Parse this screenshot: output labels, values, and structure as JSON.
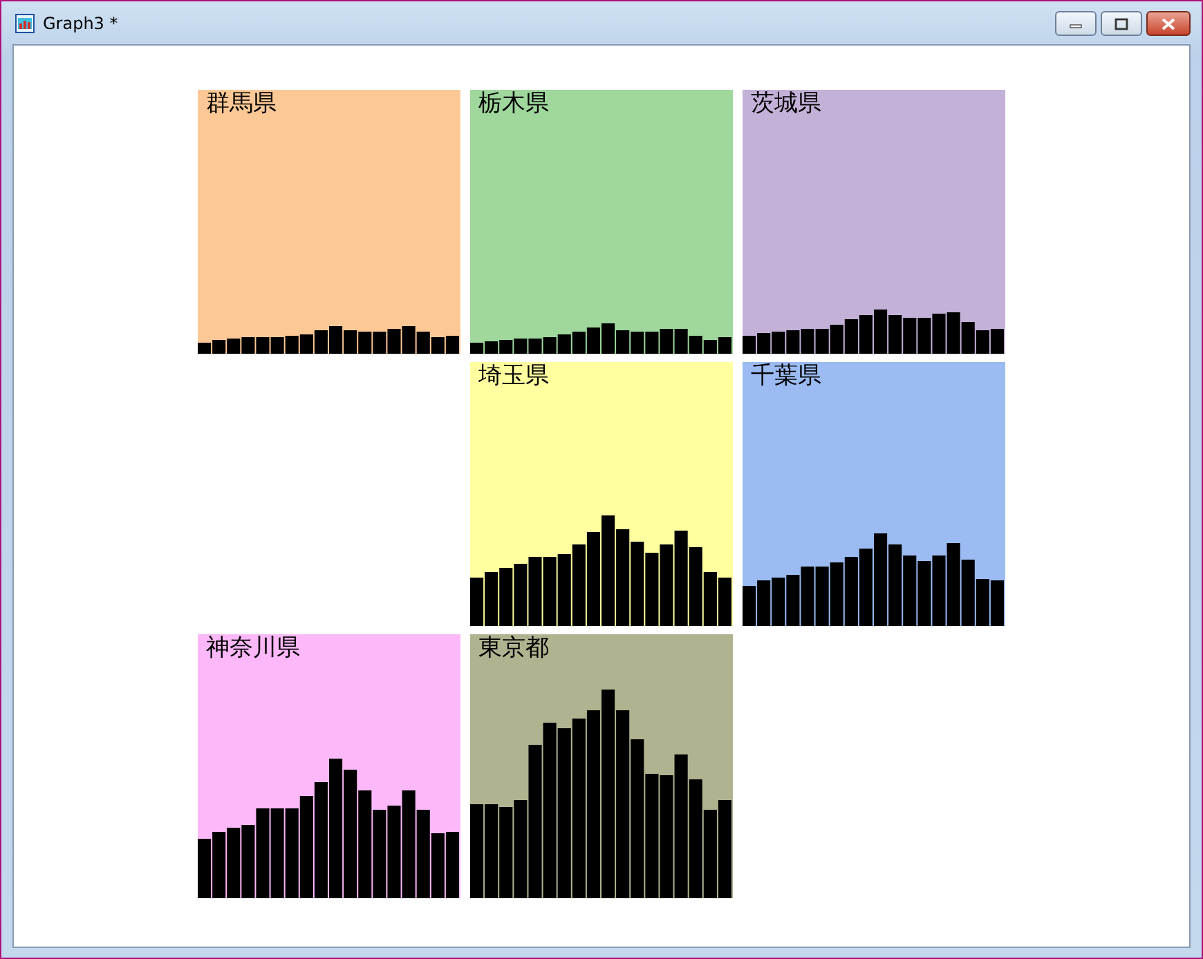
{
  "window": {
    "title": "Graph3 *"
  },
  "panels": [
    {
      "label": "群馬県",
      "color": "#fcc896"
    },
    {
      "label": "栃木県",
      "color": "#9fd79d"
    },
    {
      "label": "茨城県",
      "color": "#c3b1d7"
    },
    {
      "label": "埼玉県",
      "color": "#ffffa0"
    },
    {
      "label": "千葉県",
      "color": "#9bbbf2"
    },
    {
      "label": "神奈川県",
      "color": "#fcb8f8"
    },
    {
      "label": "東京都",
      "color": "#b1b390"
    }
  ]
}
